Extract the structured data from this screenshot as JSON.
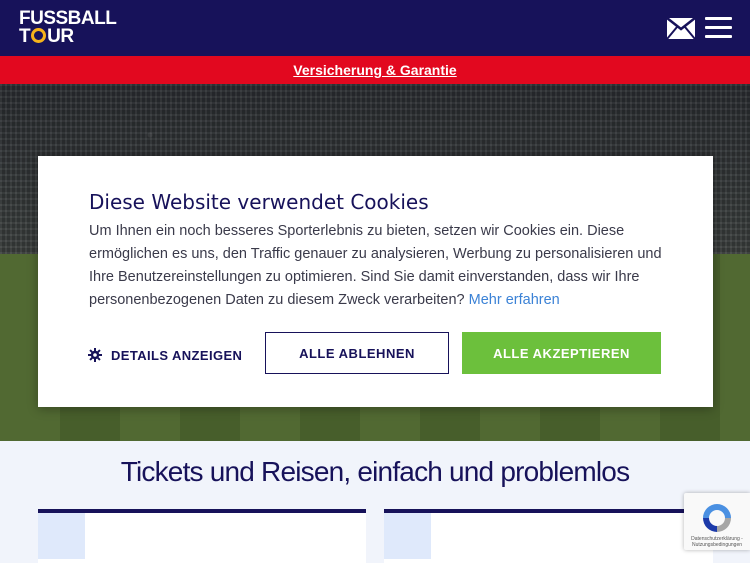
{
  "header": {
    "logo_line1": "FUSSBALL",
    "logo_line2_a": "T",
    "logo_line2_b": "UR",
    "icons": [
      "mail-icon",
      "menu-icon"
    ]
  },
  "promo": {
    "link_text": "Versicherung & Garantie"
  },
  "cookie": {
    "title": "Diese Website verwendet Cookies",
    "text": "Um Ihnen ein noch besseres Sporterlebnis zu bieten, setzen wir Cookies ein. Diese ermöglichen es uns, den Traffic genauer zu analysieren, Werbung zu personalisieren und Ihre Benutzereinstellungen zu optimieren. Sind Sie damit einverstanden, dass wir Ihre personenbezogenen Daten zu diesem Zweck verarbeiten?",
    "more_link": "Mehr erfahren",
    "details_label": "DETAILS ANZEIGEN",
    "decline_label": "ALLE ABLEHNEN",
    "accept_label": "ALLE AKZEPTIEREN"
  },
  "section": {
    "title": "Tickets und Reisen, einfach und problemlos"
  },
  "recaptcha": {
    "small_text": "Datenschutzerklärung - Nutzungsbedingungen"
  },
  "colors": {
    "brand_navy": "#17125a",
    "promo_red": "#e2081f",
    "accept_green": "#6cc03c",
    "logo_yellow": "#f6b31b",
    "link_blue": "#3b82d6"
  }
}
